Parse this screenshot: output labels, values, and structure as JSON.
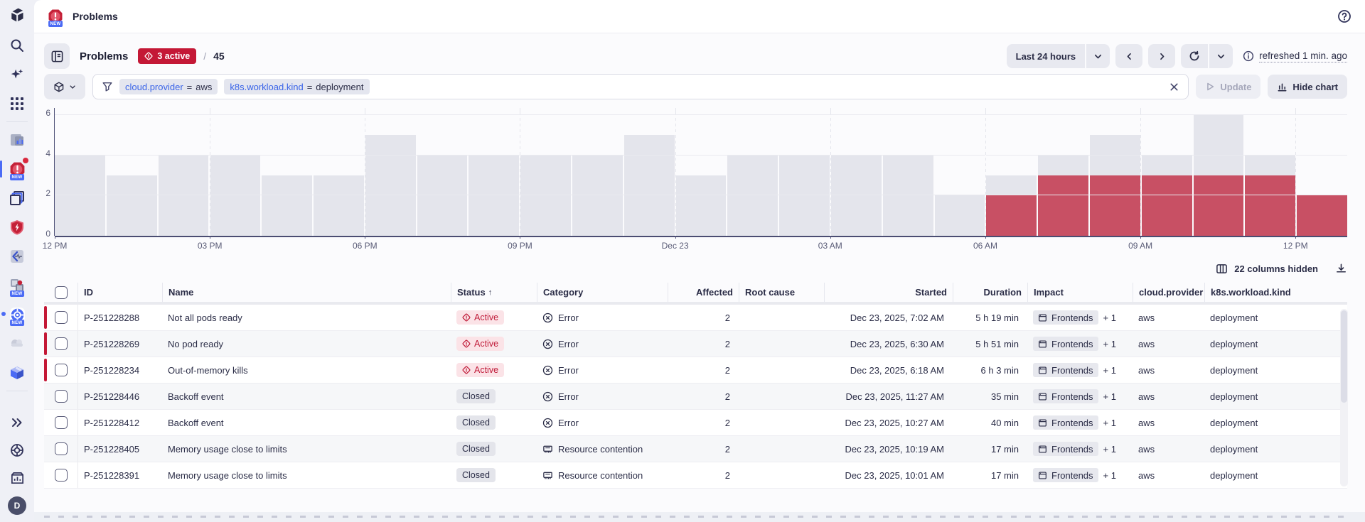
{
  "topbar": {
    "app_name": "Problems"
  },
  "page_header": {
    "title": "Problems",
    "active_count_badge": "3 active",
    "count_separator": "/",
    "total_count": "45"
  },
  "time_controls": {
    "range_label": "Last 24 hours",
    "refreshed_label": "refreshed 1 min. ago"
  },
  "filter_bar": {
    "segments": [
      {
        "key": "cloud.provider",
        "operator": "=",
        "value": "aws"
      },
      {
        "key": "k8s.workload.kind",
        "operator": "=",
        "value": "deployment"
      }
    ],
    "update_label": "Update",
    "hide_chart_label": "Hide chart"
  },
  "chart_data": {
    "type": "bar",
    "stacked": true,
    "x_unit": "hour",
    "x_tick_labels": [
      "12 PM",
      "03 PM",
      "06 PM",
      "09 PM",
      "Dec 23",
      "03 AM",
      "06 AM",
      "09 AM",
      "12 PM"
    ],
    "x_tick_positions": [
      0,
      3,
      6,
      9,
      12,
      15,
      18,
      21,
      24
    ],
    "y_ticks": [
      0,
      2,
      4,
      6
    ],
    "ylim": [
      0,
      6
    ],
    "grid": true,
    "legend": "none",
    "series": [
      {
        "name": "closed",
        "color": "#e4e5ec",
        "values": [
          4,
          3,
          4,
          4,
          3,
          3,
          5,
          4,
          4,
          4,
          4,
          5,
          3,
          4,
          4,
          4,
          4,
          2,
          1,
          1,
          2,
          1,
          3,
          1,
          0
        ]
      },
      {
        "name": "active",
        "color": "#c85064",
        "values": [
          0,
          0,
          0,
          0,
          0,
          0,
          0,
          0,
          0,
          0,
          0,
          0,
          0,
          0,
          0,
          0,
          0,
          0,
          2,
          3,
          3,
          3,
          3,
          3,
          2
        ]
      }
    ]
  },
  "table": {
    "columns_hidden_label": "22 columns hidden",
    "sorted_column": "Status",
    "sort_direction": "asc",
    "columns": [
      "ID",
      "Name",
      "Status",
      "Category",
      "Affected",
      "Root cause",
      "Started",
      "Duration",
      "Impact",
      "cloud.provider",
      "k8s.workload.kind"
    ],
    "rows": [
      {
        "id": "P-251228288",
        "name": "Not all pods ready",
        "status": "Active",
        "category": "Error",
        "affected": "2",
        "root_cause": "",
        "started": "Dec 23, 2025, 7:02 AM",
        "duration": "5 h 19 min",
        "impact": "Frontends",
        "impact_more": "+ 1",
        "cloud_provider": "aws",
        "k8s_workload_kind": "deployment"
      },
      {
        "id": "P-251228269",
        "name": "No pod ready",
        "status": "Active",
        "category": "Error",
        "affected": "2",
        "root_cause": "",
        "started": "Dec 23, 2025, 6:30 AM",
        "duration": "5 h 51 min",
        "impact": "Frontends",
        "impact_more": "+ 1",
        "cloud_provider": "aws",
        "k8s_workload_kind": "deployment"
      },
      {
        "id": "P-251228234",
        "name": "Out-of-memory kills",
        "status": "Active",
        "category": "Error",
        "affected": "2",
        "root_cause": "",
        "started": "Dec 23, 2025, 6:18 AM",
        "duration": "6 h 3 min",
        "impact": "Frontends",
        "impact_more": "+ 1",
        "cloud_provider": "aws",
        "k8s_workload_kind": "deployment"
      },
      {
        "id": "P-251228446",
        "name": "Backoff event",
        "status": "Closed",
        "category": "Error",
        "affected": "2",
        "root_cause": "",
        "started": "Dec 23, 2025, 11:27 AM",
        "duration": "35 min",
        "impact": "Frontends",
        "impact_more": "+ 1",
        "cloud_provider": "aws",
        "k8s_workload_kind": "deployment"
      },
      {
        "id": "P-251228412",
        "name": "Backoff event",
        "status": "Closed",
        "category": "Error",
        "affected": "2",
        "root_cause": "",
        "started": "Dec 23, 2025, 10:27 AM",
        "duration": "40 min",
        "impact": "Frontends",
        "impact_more": "+ 1",
        "cloud_provider": "aws",
        "k8s_workload_kind": "deployment"
      },
      {
        "id": "P-251228405",
        "name": "Memory usage close to limits",
        "status": "Closed",
        "category": "Resource contention",
        "affected": "2",
        "root_cause": "",
        "started": "Dec 23, 2025, 10:19 AM",
        "duration": "17 min",
        "impact": "Frontends",
        "impact_more": "+ 1",
        "cloud_provider": "aws",
        "k8s_workload_kind": "deployment"
      },
      {
        "id": "P-251228391",
        "name": "Memory usage close to limits",
        "status": "Closed",
        "category": "Resource contention",
        "affected": "2",
        "root_cause": "",
        "started": "Dec 23, 2025, 10:01 AM",
        "duration": "17 min",
        "impact": "Frontends",
        "impact_more": "+ 1",
        "cloud_provider": "aws",
        "k8s_workload_kind": "deployment"
      }
    ]
  },
  "sidebar": {
    "items": [
      "dynatrace-logo",
      "search",
      "ai-assistant",
      "app-launcher",
      "dashboards-app",
      "problems-app",
      "kubernetes-app",
      "security-app",
      "tracing-app",
      "infrastructure-app",
      "services-app",
      "clouds-app",
      "deployments-app",
      "expand",
      "support",
      "whats-new",
      "user-avatar"
    ],
    "avatar_initial": "D",
    "new_badge_label": "NEW"
  },
  "colors": {
    "accent_red": "#c41836",
    "active_bar": "#c85064",
    "closed_bar": "#e4e5ec",
    "link_blue": "#3a64e8",
    "selection_blue": "#4b6bf5"
  }
}
